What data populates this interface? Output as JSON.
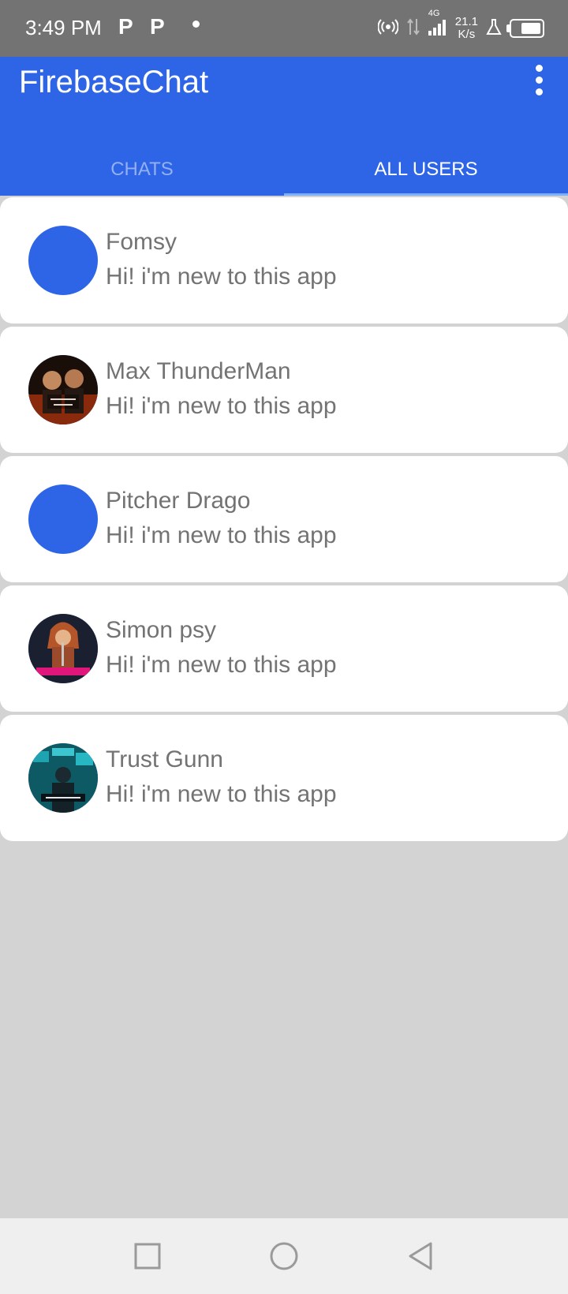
{
  "status_bar": {
    "time": "3:49 PM",
    "notif_icon_1": "P",
    "notif_icon_2": "P",
    "network_type": "4G",
    "speed_value": "21.1",
    "speed_unit": "K/s",
    "battery_level": 0.7
  },
  "app_bar": {
    "title": "FirebaseChat",
    "menu_icon": "more-vert-icon",
    "accent_color": "#2e64e6"
  },
  "tabs": [
    {
      "label": "CHATS",
      "active": false
    },
    {
      "label": "ALL USERS",
      "active": true
    }
  ],
  "users": [
    {
      "name": "Fomsy",
      "status": "Hi! i'm new to this app",
      "avatar": "default-avatar"
    },
    {
      "name": "Max ThunderMan",
      "status": "Hi! i'm new to this app",
      "avatar": "gray-man-poster"
    },
    {
      "name": "Pitcher Drago",
      "status": "Hi! i'm new to this app",
      "avatar": "default-avatar"
    },
    {
      "name": "Simon psy",
      "status": "Hi! i'm new to this app",
      "avatar": "princess-poster"
    },
    {
      "name": "Trust Gunn",
      "status": "Hi! i'm new to this app",
      "avatar": "attack-poster"
    }
  ],
  "nav_bar": {
    "recents_icon": "square-icon",
    "home_icon": "circle-icon",
    "back_icon": "triangle-back-icon"
  }
}
